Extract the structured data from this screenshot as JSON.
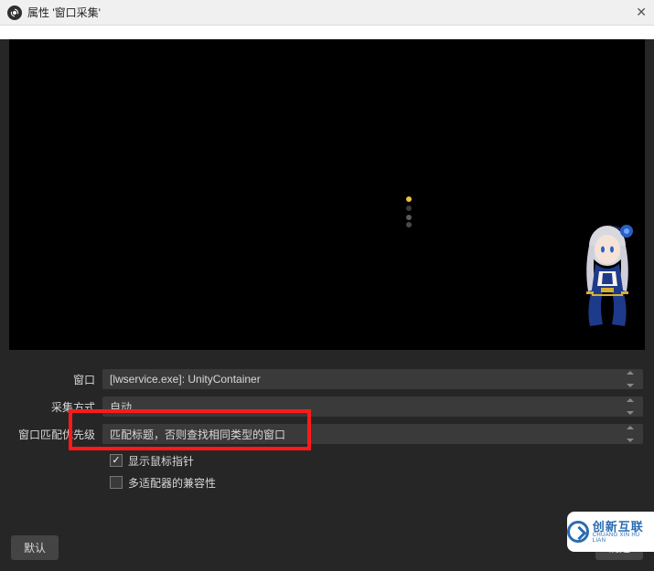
{
  "window": {
    "title": "属性 '窗口采集'",
    "close_glyph": "✕"
  },
  "form": {
    "window_label": "窗口",
    "window_value": "[lwservice.exe]: UnityContainer",
    "capture_method_label": "采集方式",
    "capture_method_value": "自动",
    "match_priority_label": "窗口匹配优先级",
    "match_priority_value": "匹配标题，否则查找相同类型的窗口",
    "show_cursor_label": "显示鼠标指针",
    "show_cursor_checked": true,
    "multi_adapter_label": "多适配器的兼容性",
    "multi_adapter_checked": false
  },
  "buttons": {
    "defaults": "默认",
    "ok": "确定"
  },
  "watermark": {
    "cn": "创新互联",
    "en": "CHUANG XIN HU LIAN"
  }
}
